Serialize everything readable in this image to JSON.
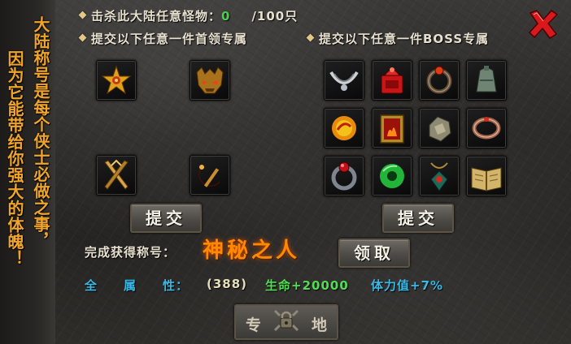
{
  "sidebar": {
    "col1": "大陆称号是每个侠士必做之事，",
    "col2": "因为它能带给你强大的体魄！"
  },
  "header": {
    "kill_label": "击杀此大陆任意怪物：",
    "kill_count": "0",
    "kill_total": "/100只",
    "submit_leader_label": "提交以下任意一件首领专属",
    "submit_boss_label": "提交以下任意一件BOSS专属"
  },
  "leader_items": [
    "golden-star-emblem-icon",
    "demon-helmet-icon",
    "crossed-blades-icon",
    "red-sickle-icon"
  ],
  "boss_items": [
    "white-necklace-icon",
    "red-seal-icon",
    "dragon-ring-icon",
    "bronze-bell-icon",
    "fire-orb-icon",
    "fire-painting-icon",
    "jade-stone-icon",
    "red-bracelet-icon",
    "gem-ring-icon",
    "green-jade-ring-icon",
    "gem-amulet-icon",
    "open-book-icon"
  ],
  "buttons": {
    "submit_left": "提交",
    "submit_right": "提交",
    "claim": "领取",
    "exclusive_left": "专",
    "exclusive_right": "地"
  },
  "reward": {
    "label": "完成获得称号：",
    "title_name": "神秘之人"
  },
  "attributes": {
    "label_chars": [
      "全",
      "属",
      "性："
    ],
    "all_stats": "(388)",
    "life": "生命+20000",
    "stamina": "体力值+7%"
  },
  "colors": {
    "accent_orange": "#ff8a00",
    "sidebar_text": "#f0a52a",
    "green": "#48d048",
    "cyan": "#39b9e6",
    "close_red": "#d8181c"
  }
}
